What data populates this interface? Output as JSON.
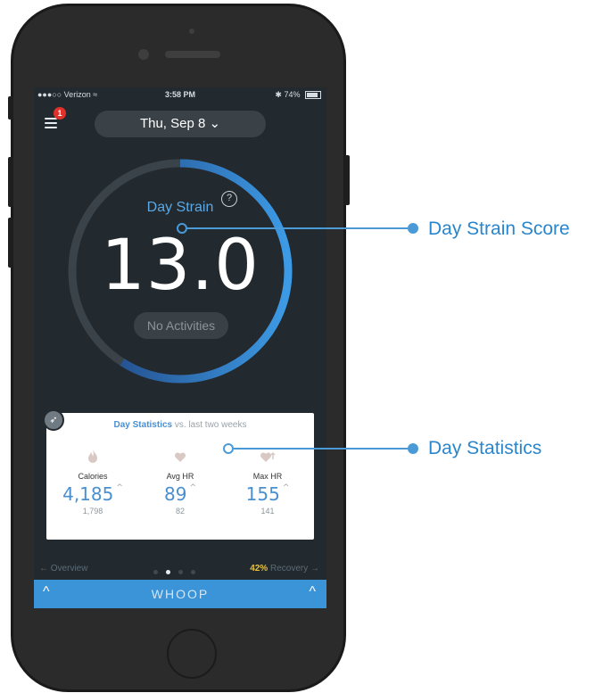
{
  "status_bar": {
    "carrier": "●●●○○ Verizon ≈",
    "time": "3:58 PM",
    "bluetooth": "✱",
    "battery_text": "74%"
  },
  "header": {
    "notification_count": "1",
    "date": "Thu, Sep 8 ⌄"
  },
  "strain": {
    "label": "Day Strain",
    "help": "?",
    "value": "13.0",
    "activities": "No Activities",
    "progress_fraction": 0.59,
    "accent_color": "#2a7fd0"
  },
  "stats": {
    "title_bold": "Day Statistics",
    "title_rest": " vs. last two weeks",
    "items": [
      {
        "icon": "flame-icon",
        "label": "Calories",
        "value": "4,185",
        "trend": "^",
        "baseline": "1,798"
      },
      {
        "icon": "heart-icon",
        "label": "Avg HR",
        "value": "89",
        "trend": "^",
        "baseline": "82"
      },
      {
        "icon": "heart-up-icon",
        "label": "Max HR",
        "value": "155",
        "trend": "^",
        "baseline": "141"
      }
    ]
  },
  "nav": {
    "left": "← Overview",
    "recovery_pct": "42%",
    "right": " Recovery →",
    "active_page": 1,
    "page_count": 4
  },
  "footer": {
    "brand": "WHOOP",
    "chevron": "^"
  },
  "callouts": {
    "strain": "Day Strain Score",
    "stats": "Day Statistics"
  }
}
